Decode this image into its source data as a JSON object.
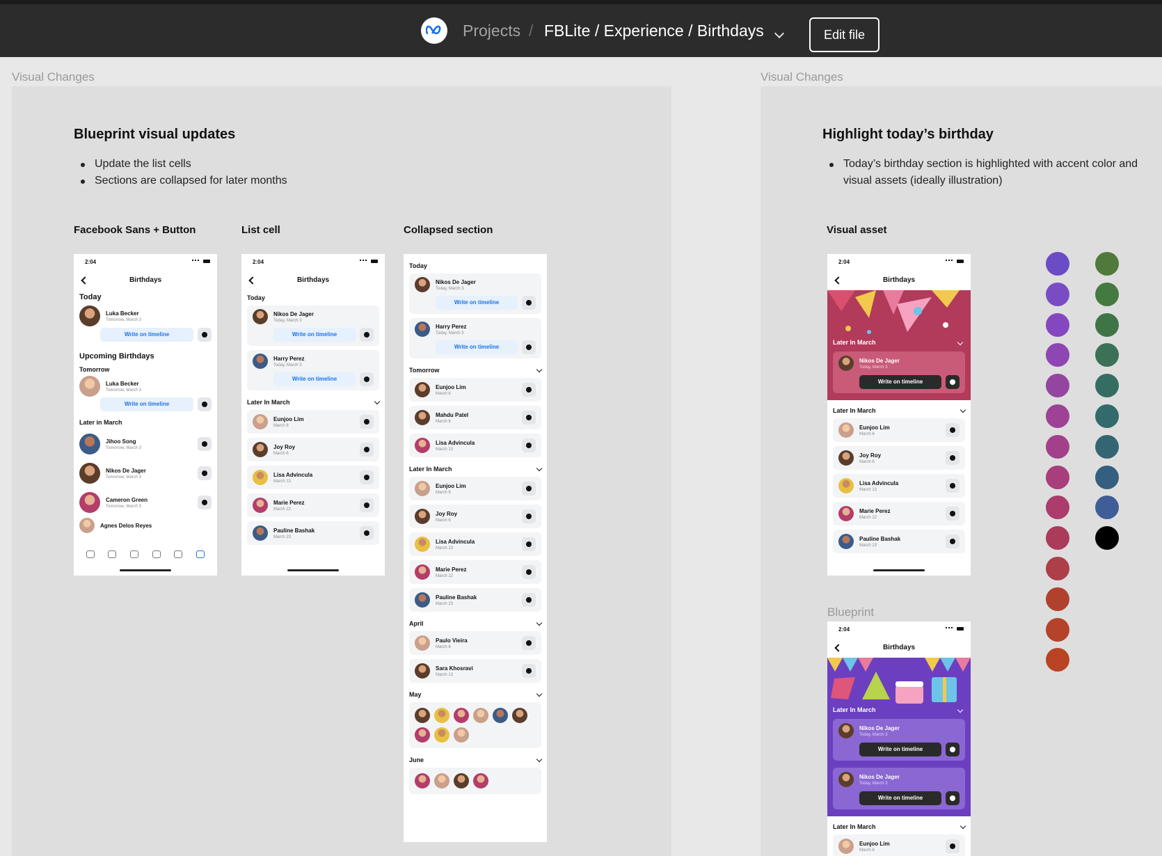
{
  "header": {
    "projects": "Projects",
    "separator": "/",
    "path": "FBLite / Experience / Birthdays",
    "edit_button": "Edit file"
  },
  "left_frame": {
    "label": "Visual Changes",
    "title": "Blueprint visual updates",
    "bullets": [
      "Update the list cells",
      "Sections are collapsed for later months"
    ],
    "col1_title": "Facebook Sans + Button",
    "col2_title": "List cell",
    "col3_title": "Collapsed section"
  },
  "right_frame": {
    "label": "Visual Changes",
    "title": "Highlight today’s birthday",
    "bullet_line1": "Today’s birthday section is highlighted with accent color and",
    "bullet_line2": "visual assets (ideally illustration)",
    "visual_asset_title": "Visual asset",
    "blueprint_label": "Blueprint"
  },
  "phone": {
    "time": "2:04",
    "title": "Birthdays",
    "write": "Write on timeline"
  },
  "phone1": {
    "today": "Today",
    "upcoming": "Upcoming Birthdays",
    "tomorrow": "Tomorrow",
    "later": "Later in March",
    "people": [
      {
        "name": "Luka Becker",
        "date": "Tomorrow, March 3"
      },
      {
        "name": "Luka Becker",
        "date": "Tomorrow, March 3"
      },
      {
        "name": "Jihoo Song",
        "date": "Tomorrow, March 3"
      },
      {
        "name": "Nikos De Jager",
        "date": "Tomorrow, March 3"
      },
      {
        "name": "Cameron Green",
        "date": "Tomorrow, March 3"
      },
      {
        "name": "Agnes Delos Reyes",
        "date": ""
      }
    ]
  },
  "phone2": {
    "today": "Today",
    "later": "Later In March",
    "today_people": [
      {
        "name": "Nikos De Jager",
        "date": "Today, March 3"
      },
      {
        "name": "Harry Perez",
        "date": "Today, March 3"
      }
    ],
    "later_people": [
      {
        "name": "Eunjoo Lim",
        "date": "March 6"
      },
      {
        "name": "Joy Roy",
        "date": "March 6"
      },
      {
        "name": "Lisa Advincula",
        "date": "March 13"
      },
      {
        "name": "Marie Perez",
        "date": "March 22"
      },
      {
        "name": "Pauline Bashak",
        "date": "March 23"
      }
    ]
  },
  "phone3": {
    "today": "Today",
    "tomorrow": "Tomorrow",
    "later": "Later In March",
    "april": "April",
    "may": "May",
    "june": "June",
    "today_people": [
      {
        "name": "Nikos De Jager",
        "date": "Today, March 3"
      },
      {
        "name": "Harry Perez",
        "date": "Today, March 3"
      }
    ],
    "tomorrow_people": [
      {
        "name": "Eunjoo Lim",
        "date": "March 6"
      },
      {
        "name": "Mahdu Patel",
        "date": "March 6"
      },
      {
        "name": "Lisa Advincula",
        "date": "March 13"
      }
    ],
    "later_people": [
      {
        "name": "Eunjoo Lim",
        "date": "March 6"
      },
      {
        "name": "Joy Roy",
        "date": "March 6"
      },
      {
        "name": "Lisa Advincula",
        "date": "March 13"
      },
      {
        "name": "Marie Perez",
        "date": "March 22"
      },
      {
        "name": "Pauline Bashak",
        "date": "March 23"
      }
    ],
    "april_people": [
      {
        "name": "Paulo Vieira",
        "date": "March 6"
      },
      {
        "name": "Sara Khosravi",
        "date": "March 13"
      }
    ]
  },
  "phone4": {
    "later_hero": "Later In March",
    "hero_person": {
      "name": "Nikos De Jager",
      "date": "Today, March 3"
    },
    "later": "Later In March",
    "people": [
      {
        "name": "Eunjoo Lim",
        "date": "March 6"
      },
      {
        "name": "Joy Roy",
        "date": "March 6"
      },
      {
        "name": "Lisa Advincula",
        "date": "March 13"
      },
      {
        "name": "Marie Perez",
        "date": "March 22"
      },
      {
        "name": "Pauline Bashak",
        "date": "March 23"
      }
    ]
  },
  "phone5": {
    "later_hero": "Later In March",
    "hero_people": [
      {
        "name": "Nikos De Jager",
        "date": "Today, March 3"
      },
      {
        "name": "Nikos De Jager",
        "date": "Today, March 3"
      }
    ],
    "later": "Later In March",
    "people": [
      {
        "name": "Eunjoo Lim",
        "date": "March 6"
      }
    ]
  },
  "swatches": {
    "col1": [
      "#6a4cc7",
      "#7a4cc4",
      "#8547c0",
      "#8e46b2",
      "#94459f",
      "#9d4294",
      "#a2408a",
      "#a83e7b",
      "#ab3c6b",
      "#ab3b5a",
      "#ad3f48",
      "#b0412f",
      "#b4432a",
      "#b94423"
    ],
    "col2": [
      "#4f7a3b",
      "#447a3f",
      "#3f7447",
      "#3a7157",
      "#356d63",
      "#336a6b",
      "#336672",
      "#355f80",
      "#3f5e98",
      "#000000"
    ]
  }
}
